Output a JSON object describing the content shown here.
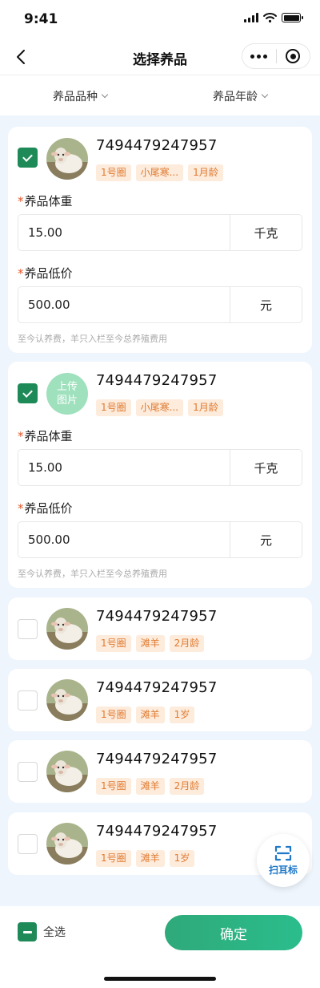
{
  "status": {
    "time": "9:41"
  },
  "nav": {
    "title": "选择养品"
  },
  "filters": [
    {
      "label": "养品品种"
    },
    {
      "label": "养品年龄"
    }
  ],
  "form": {
    "weight_label": "养品体重",
    "price_label": "养品低价",
    "hint": "至今认养费，羊只入栏至今总养殖费用",
    "upload_label": "上传\n图片"
  },
  "items": [
    {
      "id": "7494479247957",
      "checked": true,
      "avatar": "sheep-photo",
      "tags": [
        "1号圈",
        "小尾寒...",
        "1月龄"
      ],
      "weight": "15.00",
      "weight_unit": "千克",
      "price": "500.00",
      "price_unit": "元"
    },
    {
      "id": "7494479247957",
      "checked": true,
      "avatar": "upload",
      "tags": [
        "1号圈",
        "小尾寒...",
        "1月龄"
      ],
      "weight": "15.00",
      "weight_unit": "千克",
      "price": "500.00",
      "price_unit": "元"
    },
    {
      "id": "7494479247957",
      "checked": false,
      "avatar": "sheep-photo",
      "tags": [
        "1号圈",
        "滩羊",
        "2月龄"
      ]
    },
    {
      "id": "7494479247957",
      "checked": false,
      "avatar": "sheep-photo",
      "tags": [
        "1号圈",
        "滩羊",
        "1岁"
      ]
    },
    {
      "id": "7494479247957",
      "checked": false,
      "avatar": "sheep-photo",
      "tags": [
        "1号圈",
        "滩羊",
        "2月龄"
      ]
    },
    {
      "id": "7494479247957",
      "checked": false,
      "avatar": "sheep-photo",
      "tags": [
        "1号圈",
        "滩羊",
        "1岁"
      ]
    }
  ],
  "scan": {
    "label": "扫耳标",
    "icon": "scan-icon"
  },
  "bottom": {
    "select_all": "全选",
    "confirm": "确定"
  },
  "colors": {
    "primary_green": "#1e8a57",
    "tag_bg": "#fdebdc",
    "tag_text": "#e07a2f",
    "scan_blue": "#1f78c8"
  }
}
